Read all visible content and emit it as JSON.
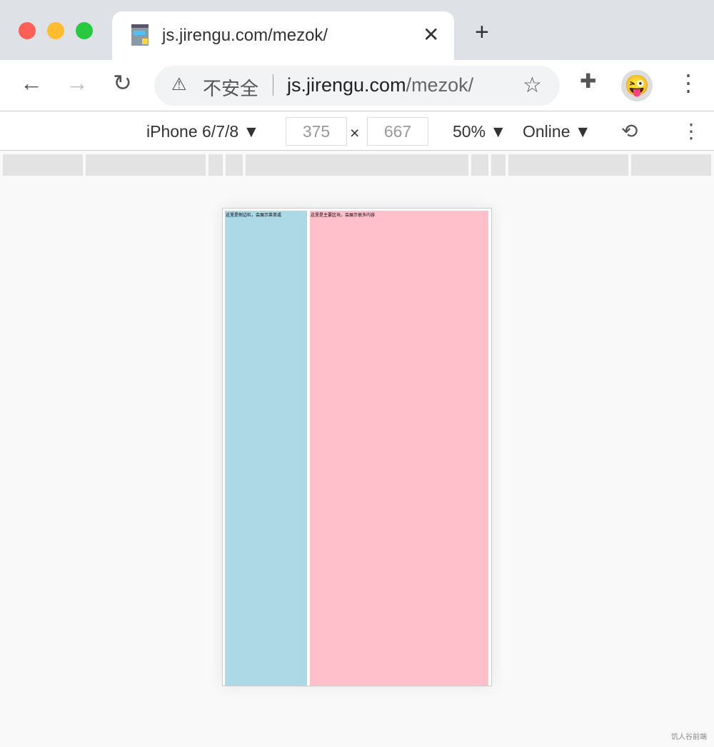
{
  "tab": {
    "title": "js.jirengu.com/mezok/",
    "close": "✕",
    "new_tab": "+"
  },
  "omnibox": {
    "security": "不安全",
    "host": "js.jirengu.com",
    "path": "/mezok/"
  },
  "devtools": {
    "device": "iPhone 6/7/8 ▼",
    "width": "375",
    "height": "667",
    "times": "×",
    "zoom": "50% ▼",
    "network": "Online ▼"
  },
  "page": {
    "aside_text": "这里是侧边栏，会展示菜单或",
    "main_text": "这里是主要区块，会展示很多内容"
  },
  "watermark": "饥人谷前端",
  "colors": {
    "aside": "#add8e6",
    "main": "#ffc0cb"
  }
}
